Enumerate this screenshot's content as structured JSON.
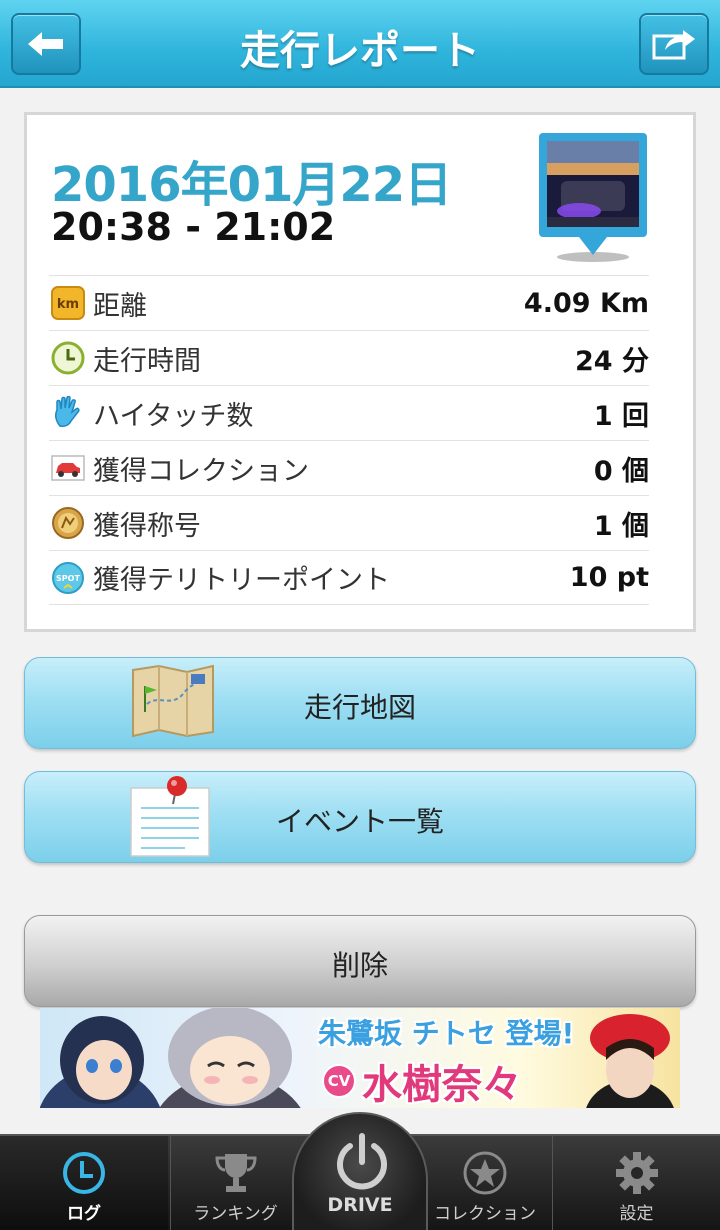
{
  "header": {
    "title": "走行レポート"
  },
  "report": {
    "date": "2016年01月22日",
    "time_range": "20:38 - 21:02",
    "stats": [
      {
        "icon": "km-icon",
        "icon_text": "km",
        "label": "距離",
        "value": "4.09 Km"
      },
      {
        "icon": "clock-icon",
        "label": "走行時間",
        "value": "24 分"
      },
      {
        "icon": "high-five-hand-icon",
        "label": "ハイタッチ数",
        "value": "1 回"
      },
      {
        "icon": "car-icon",
        "label": "獲得コレクション",
        "value": "0 個"
      },
      {
        "icon": "title-medal-icon",
        "label": "獲得称号",
        "value": "1 個"
      },
      {
        "icon": "spot-icon",
        "icon_text": "SPOT",
        "label": "獲得テリトリーポイント",
        "value": "10 pt"
      }
    ]
  },
  "buttons": {
    "map": "走行地図",
    "events": "イベント一覧",
    "delete": "削除"
  },
  "banner": {
    "headline": "朱鷺坂 チトセ 登場!",
    "cv_badge": "CV",
    "voice_actor": "水樹奈々"
  },
  "tabbar": {
    "items": [
      {
        "label": "ログ",
        "icon": "clock-icon",
        "active": true
      },
      {
        "label": "ランキング",
        "icon": "trophy-icon"
      },
      {
        "label": "DRIVE",
        "icon": "power-icon"
      },
      {
        "label": "コレクション",
        "icon": "star-icon"
      },
      {
        "label": "設定",
        "icon": "gear-icon"
      }
    ]
  },
  "colors": {
    "header": "#2fb4dc",
    "date": "#35a6c9",
    "button": "#9fdff3"
  }
}
